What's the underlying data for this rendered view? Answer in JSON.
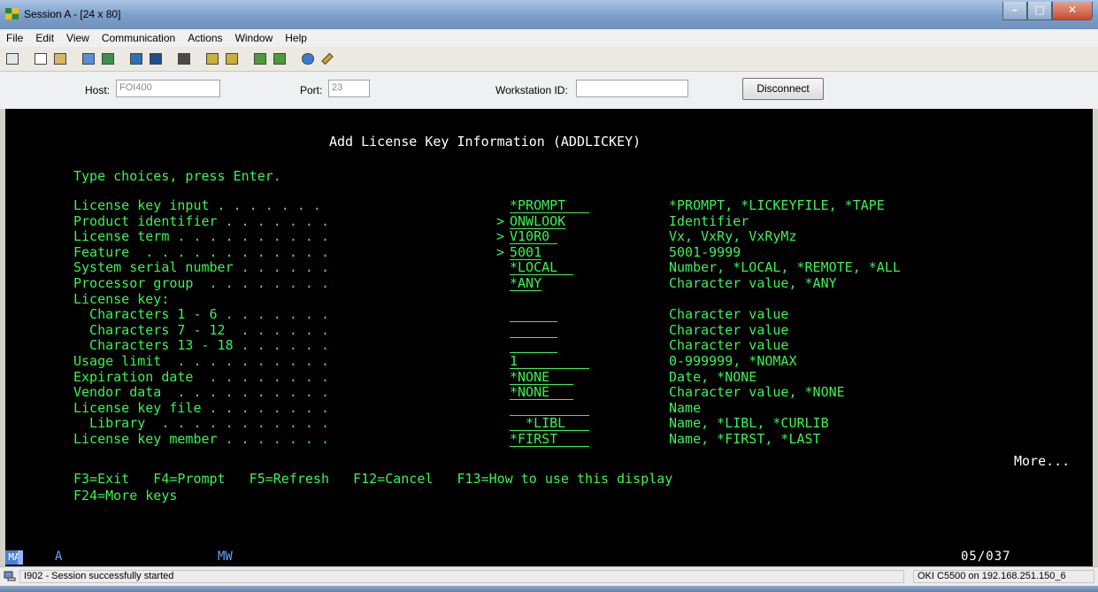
{
  "window": {
    "title": "Session A - [24 x 80]",
    "colors": {
      "titlebar": "#7d9fc9",
      "terminal_bg": "#000000",
      "terminal_fg": "#3cf252",
      "terminal_white": "#ffffff",
      "oia_blue": "#5aa6ff"
    }
  },
  "menu": [
    "File",
    "Edit",
    "View",
    "Communication",
    "Actions",
    "Window",
    "Help"
  ],
  "toolbar": {
    "icons": [
      "print-screen-icon",
      "copy-icon",
      "paste-icon",
      "send-file-icon",
      "receive-file-icon",
      "display-icon",
      "keyboard-icon",
      "macro-icon",
      "record-macro-icon",
      "stop-macro-icon",
      "play-macro-icon",
      "customize-icon",
      "color-palette-icon",
      "edit-icon"
    ]
  },
  "connection": {
    "host_label": "Host:",
    "host_value": "FOI400",
    "port_label": "Port:",
    "port_value": "23",
    "workstation_label": "Workstation ID:",
    "workstation_value": "",
    "disconnect_label": "Disconnect"
  },
  "screen": {
    "title": "Add License Key Information (ADDLICKEY)",
    "instruction": "Type choices, press Enter.",
    "rows": [
      {
        "label": "License key input . . . . . . .",
        "marker": "",
        "value": "*PROMPT",
        "field_width": 10,
        "hint": "*PROMPT, *LICKEYFILE, *TAPE"
      },
      {
        "label": "Product identifier . . . . . . .",
        "marker": ">",
        "value": "ONWLOOK",
        "field_width": 7,
        "hint": "Identifier"
      },
      {
        "label": "License term . . . . . . . . . .",
        "marker": ">",
        "value": "V10R0",
        "field_width": 6,
        "hint": "Vx, VxRy, VxRyMz"
      },
      {
        "label": "Feature  . . . . . . . . . . . .",
        "marker": ">",
        "value": "5001",
        "field_width": 4,
        "hint": "5001-9999"
      },
      {
        "label": "System serial number . . . . . .",
        "marker": "",
        "value": "*LOCAL",
        "field_width": 8,
        "hint": "Number, *LOCAL, *REMOTE, *ALL"
      },
      {
        "label": "Processor group  . . . . . . . .",
        "marker": "",
        "value": "*ANY",
        "field_width": 4,
        "hint": "Character value, *ANY"
      },
      {
        "label": "License key:",
        "marker": "",
        "value": null,
        "field_width": 0,
        "hint": ""
      },
      {
        "label": "  Characters 1 - 6 . . . . . . .",
        "marker": "",
        "value": "",
        "field_width": 6,
        "hint": "Character value"
      },
      {
        "label": "  Characters 7 - 12  . . . . . .",
        "marker": "",
        "value": "",
        "field_width": 6,
        "hint": "Character value"
      },
      {
        "label": "  Characters 13 - 18 . . . . . .",
        "marker": "",
        "value": "",
        "field_width": 6,
        "hint": "Character value"
      },
      {
        "label": "Usage limit  . . . . . . . . . .",
        "marker": "",
        "value": "1",
        "field_width": 10,
        "hint": "0-999999, *NOMAX"
      },
      {
        "label": "Expiration date  . . . . . . . .",
        "marker": "",
        "value": "*NONE",
        "field_width": 8,
        "hint": "Date, *NONE"
      },
      {
        "label": "Vendor data  . . . . . . . . . .",
        "marker": "",
        "value": "*NONE",
        "field_width": 8,
        "hint": "Character value, *NONE"
      },
      {
        "label": "License key file . . . . . . . .",
        "marker": "",
        "value": "",
        "field_width": 10,
        "hint": "Name"
      },
      {
        "label": "  Library  . . . . . . . . . . .",
        "marker": "",
        "value": "  *LIBL",
        "field_width": 10,
        "hint": "Name, *LIBL, *CURLIB"
      },
      {
        "label": "License key member . . . . . . .",
        "marker": "",
        "value": "*FIRST",
        "field_width": 10,
        "hint": "Name, *FIRST, *LAST"
      }
    ],
    "more": "More...",
    "fkeys_line1": "F3=Exit   F4=Prompt   F5=Refresh   F12=Cancel   F13=How to use this display",
    "fkeys_line2": "F24=More keys"
  },
  "oia": {
    "mode": "MA",
    "indicator": "A",
    "input_mode": "MW",
    "cursor_position": "05/037"
  },
  "status": {
    "message": "I902 - Session successfully started",
    "printer": "OKI C5500 on 192.168.251.150_6"
  }
}
